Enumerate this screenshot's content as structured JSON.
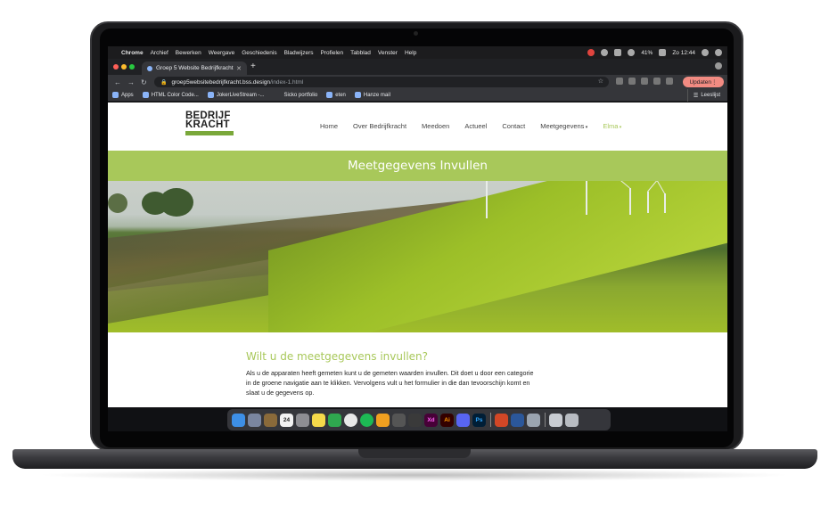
{
  "menubar": {
    "app": "Chrome",
    "items": [
      "Archief",
      "Bewerken",
      "Weergave",
      "Geschiedenis",
      "Bladwijzers",
      "Profielen",
      "Tabblad",
      "Venster",
      "Help"
    ],
    "battery": "41%",
    "clock": "Zo 12:44"
  },
  "browser": {
    "tab_title": "Groep 5 Website Bedrijfkracht",
    "url_host": "groep5websitebedrijfkracht.bss.design",
    "url_path": "/index-1.html",
    "update_label": "Updaten",
    "bookmarks": [
      "Apps",
      "HTML Color Code...",
      "JokerLiveStream -...",
      "Sicko portfolio",
      "eten",
      "Hanze mail"
    ],
    "reading_list": "Leeslijst"
  },
  "site": {
    "logo_line1": "BEDRIJF",
    "logo_line2": "KRACHT",
    "nav": [
      "Home",
      "Over Bedrijfkracht",
      "Meedoen",
      "Actueel",
      "Contact",
      "Meetgegevens",
      "Elma"
    ],
    "banner_title": "Meetgegevens Invullen",
    "heading": "Wilt u de meetgegevens invullen?",
    "paragraph": "Als u de apparaten heeft gemeten kunt u de gemeten waarden invullen. Dit doet u door een categorie in de groene navigatie aan te klikken. Vervolgens vult u het formulier in die dan tevoorschijn komt en slaat u de gegevens op.",
    "accent_color": "#a8c85a"
  },
  "dock": {
    "calendar_day": "24",
    "labels": [
      "Xd",
      "Ai",
      "Ps"
    ]
  }
}
